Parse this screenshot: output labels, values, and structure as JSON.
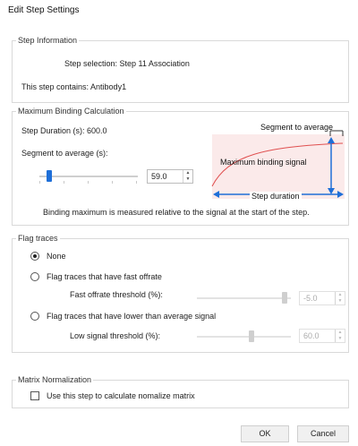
{
  "dialog": {
    "title": "Edit Step Settings"
  },
  "step_information": {
    "title": "Step Information",
    "selection_text": "Step selection: Step 11 Association",
    "contains_text": "This step contains: Antibody1"
  },
  "max_binding": {
    "title": "Maximum Binding Calculation",
    "duration_text": "Step Duration (s): 600.0",
    "segment_label": "Segment to average (s):",
    "segment_value": "59.0",
    "segment_slider_fraction": 0.1,
    "diagram": {
      "segment_label": "Segment to average",
      "signal_label": "Maximum binding signal",
      "duration_label": "Step duration",
      "curve_color": "#e05050",
      "arrow_color": "#1f6fd8"
    },
    "note": "Binding maximum is measured relative to the signal at the start of the step."
  },
  "flag_traces": {
    "title": "Flag traces",
    "options": {
      "none": "None",
      "fast": "Flag traces that have fast offrate",
      "low": "Flag traces that have lower than average signal"
    },
    "selected": "none",
    "fast_threshold_label": "Fast offrate threshold (%):",
    "fast_threshold_value": "-5.0",
    "fast_slider_fraction": 0.93,
    "low_threshold_label": "Low signal threshold (%):",
    "low_threshold_value": "60.0",
    "low_slider_fraction": 0.58
  },
  "matrix": {
    "title": "Matrix Normalization",
    "checkbox_label": "Use this step to calculate nomalize matrix",
    "checked": false
  },
  "buttons": {
    "ok": "OK",
    "cancel": "Cancel"
  },
  "colors": {
    "accent": "#1f6fd8",
    "disabled": "#cfcfcf"
  },
  "icons": {
    "spin_up": "▲",
    "spin_down": "▼",
    "radio_dot": "radio-selected-icon"
  }
}
